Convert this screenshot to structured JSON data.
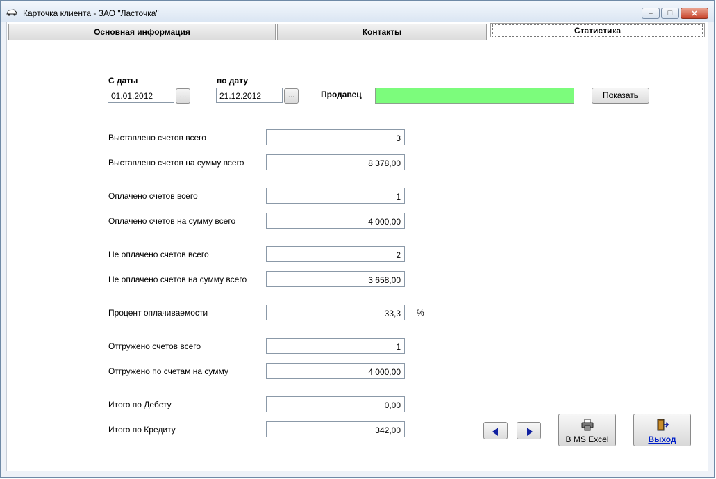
{
  "window": {
    "title": "Карточка клиента  -  ЗАО \"Ласточка\""
  },
  "tabs": [
    {
      "label": "Основная информация"
    },
    {
      "label": "Контакты"
    },
    {
      "label": "Статистика"
    }
  ],
  "filter": {
    "from_label": "С даты",
    "from_value": "01.01.2012",
    "to_label": "по дату",
    "to_value": "21.12.2012",
    "ellipsis": "...",
    "seller_label": "Продавец",
    "seller_value": "",
    "seller_color": "#7cfc7c",
    "show_button": "Показать"
  },
  "stats": [
    {
      "label": "Выставлено счетов всего",
      "value": "3"
    },
    {
      "label": "Выставлено счетов на сумму всего",
      "value": "8 378,00"
    },
    {
      "label": "Оплачено счетов всего",
      "value": "1"
    },
    {
      "label": "Оплачено счетов на сумму всего",
      "value": "4 000,00"
    },
    {
      "label": "Не оплачено счетов всего",
      "value": "2"
    },
    {
      "label": "Не оплачено счетов на сумму всего",
      "value": "3 658,00"
    },
    {
      "label": "Процент оплачиваемости",
      "value": "33,3",
      "unit": "%"
    },
    {
      "label": "Отгружено счетов всего",
      "value": "1"
    },
    {
      "label": "Отгружено по счетам на сумму",
      "value": "4 000,00"
    },
    {
      "label": "Итого по Дебету",
      "value": "0,00"
    },
    {
      "label": "Итого по Кредиту",
      "value": "342,00"
    }
  ],
  "actions": {
    "excel_label": "В MS Excel",
    "exit_label": "Выход"
  },
  "icons": {
    "app": "car-icon",
    "excel": "printer-icon",
    "exit": "exit-door-icon",
    "prev": "arrow-left-icon",
    "next": "arrow-right-icon"
  }
}
